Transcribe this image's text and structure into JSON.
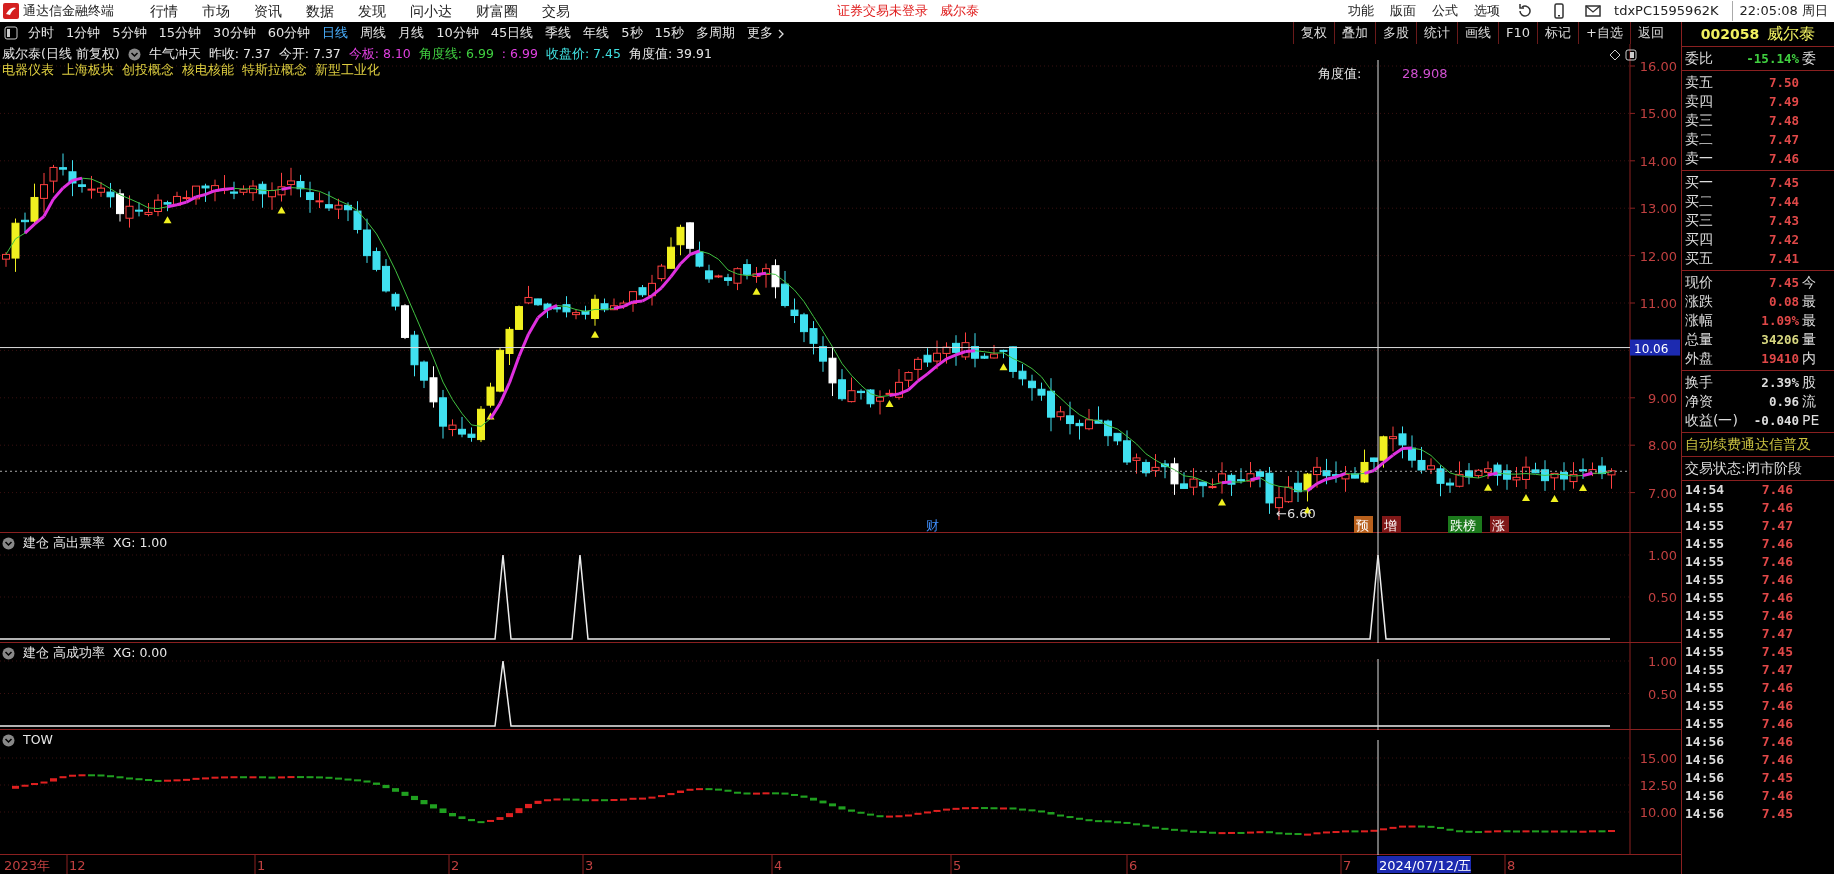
{
  "title_bar": {
    "app_title": "通达信金融终端",
    "menus": [
      "行情",
      "市场",
      "资讯",
      "数据",
      "发现",
      "问小达",
      "财富圈",
      "交易"
    ],
    "login_notice": "证券交易未登录",
    "stock_name": "威尔泰",
    "right_menus": [
      "功能",
      "版面",
      "公式",
      "选项"
    ],
    "terminal_id": "tdxPC1595962K",
    "clock": "22:05:08 周日"
  },
  "period_tabs": [
    {
      "label": "分时",
      "selected": false
    },
    {
      "label": "1分钟",
      "selected": false
    },
    {
      "label": "5分钟",
      "selected": false
    },
    {
      "label": "15分钟",
      "selected": false
    },
    {
      "label": "30分钟",
      "selected": false
    },
    {
      "label": "60分钟",
      "selected": false
    },
    {
      "label": "日线",
      "selected": true
    },
    {
      "label": "周线",
      "selected": false
    },
    {
      "label": "月线",
      "selected": false
    },
    {
      "label": "10分钟",
      "selected": false
    },
    {
      "label": "45日线",
      "selected": false
    },
    {
      "label": "季线",
      "selected": false
    },
    {
      "label": "年线",
      "selected": false
    },
    {
      "label": "5秒",
      "selected": false
    },
    {
      "label": "15秒",
      "selected": false
    },
    {
      "label": "多周期",
      "selected": false
    },
    {
      "label": "更多",
      "selected": false
    }
  ],
  "toolbar": [
    "复权",
    "叠加",
    "多股",
    "统计",
    "画线",
    "F10",
    "标记",
    "+自选",
    "返回"
  ],
  "main_chart": {
    "info": [
      {
        "text": "威尔泰(日线 前复权)",
        "color": "#e6e6e6"
      },
      {
        "text": "牛气冲天",
        "color": "#e6e6e6"
      },
      {
        "text": "昨收: 7.37",
        "color": "#e6e6e6"
      },
      {
        "text": "今开: 7.37",
        "color": "#e6e6e6"
      },
      {
        "text": "今板: 8.10",
        "color": "#e040e0"
      },
      {
        "text": "角度线: 6.99",
        "color": "#40d040"
      },
      {
        "text": ": 6.99",
        "color": "#e040e0"
      },
      {
        "text": "收盘价: 7.45",
        "color": "#40e0e0"
      },
      {
        "text": "角度值: 39.91",
        "color": "#e6e6e6"
      }
    ],
    "concepts": [
      "电器仪表",
      "上海板块",
      "创投概念",
      "核电核能",
      "特斯拉概念",
      "新型工业化"
    ],
    "angle_label": "角度值:",
    "angle_value": "28.908",
    "low_label": "←6.60",
    "cursor_price": "10.06",
    "price_axis": [
      "16.00",
      "15.00",
      "14.00",
      "13.00",
      "12.00",
      "11.00",
      "9.00",
      "8.00",
      "7.00"
    ],
    "events": [
      {
        "label": "财",
        "kind": "text",
        "color": "#4090ff"
      },
      {
        "label": "预",
        "kind": "tag",
        "color": "#b8601c"
      },
      {
        "label": "增",
        "kind": "tag",
        "color": "#801818"
      },
      {
        "label": "跌榜",
        "kind": "tag",
        "color": "#1c7a1c"
      },
      {
        "label": "涨",
        "kind": "tag",
        "color": "#801818"
      }
    ]
  },
  "indicators": [
    {
      "title": "建仓 高出票率",
      "reading": "XG: 1.00",
      "axis": [
        "1.00",
        "0.50"
      ]
    },
    {
      "title": "建仓 高成功率",
      "reading": "XG: 0.00",
      "axis": [
        "1.00",
        "0.50"
      ]
    }
  ],
  "tow": {
    "title": "TOW",
    "axis": [
      "15.00",
      "12.50",
      "10.00"
    ]
  },
  "date_axis": [
    {
      "label": "2023年",
      "selected": false
    },
    {
      "label": "12",
      "selected": false
    },
    {
      "label": "1",
      "selected": false
    },
    {
      "label": "2",
      "selected": false
    },
    {
      "label": "3",
      "selected": false
    },
    {
      "label": "4",
      "selected": false
    },
    {
      "label": "5",
      "selected": false
    },
    {
      "label": "6",
      "selected": false
    },
    {
      "label": "7",
      "selected": false
    },
    {
      "label": "2024/07/12/五",
      "selected": true
    },
    {
      "label": "8",
      "selected": false
    }
  ],
  "quote_panel": {
    "code": "002058",
    "name": "威尔泰",
    "ratio": {
      "label": "委比",
      "value": "-15.14%",
      "side": "委"
    },
    "asks": [
      {
        "label": "卖五",
        "price": "7.50"
      },
      {
        "label": "卖四",
        "price": "7.49"
      },
      {
        "label": "卖三",
        "price": "7.48"
      },
      {
        "label": "卖二",
        "price": "7.47"
      },
      {
        "label": "卖一",
        "price": "7.46"
      }
    ],
    "bids": [
      {
        "label": "买一",
        "price": "7.45"
      },
      {
        "label": "买二",
        "price": "7.44"
      },
      {
        "label": "买三",
        "price": "7.43"
      },
      {
        "label": "买四",
        "price": "7.42"
      },
      {
        "label": "买五",
        "price": "7.41"
      }
    ],
    "stats": [
      {
        "label": "现价",
        "value": "7.45",
        "side": "今",
        "color": "#e04848"
      },
      {
        "label": "涨跌",
        "value": "0.08",
        "side": "最",
        "color": "#e04848"
      },
      {
        "label": "涨幅",
        "value": "1.09%",
        "side": "最",
        "color": "#e04848"
      },
      {
        "label": "总量",
        "value": "34206",
        "side": "量",
        "color": "#d8d880"
      },
      {
        "label": "外盘",
        "value": "19410",
        "side": "内",
        "color": "#e04848"
      }
    ],
    "stats2": [
      {
        "label": "换手",
        "value": "2.39%",
        "side": "股"
      },
      {
        "label": "净资",
        "value": "0.96",
        "side": "流"
      },
      {
        "label": "收益(一)",
        "value": "-0.040",
        "side": "PE"
      }
    ],
    "notice": "自动续费通达信普及",
    "status": "交易状态:闭市阶段",
    "ticks": [
      {
        "time": "14:54",
        "price": "7.46"
      },
      {
        "time": "14:55",
        "price": "7.46"
      },
      {
        "time": "14:55",
        "price": "7.47"
      },
      {
        "time": "14:55",
        "price": "7.46"
      },
      {
        "time": "14:55",
        "price": "7.46"
      },
      {
        "time": "14:55",
        "price": "7.46"
      },
      {
        "time": "14:55",
        "price": "7.46"
      },
      {
        "time": "14:55",
        "price": "7.46"
      },
      {
        "time": "14:55",
        "price": "7.47"
      },
      {
        "time": "14:55",
        "price": "7.45"
      },
      {
        "time": "14:55",
        "price": "7.47"
      },
      {
        "time": "14:55",
        "price": "7.46"
      },
      {
        "time": "14:55",
        "price": "7.46"
      },
      {
        "time": "14:55",
        "price": "7.46"
      },
      {
        "time": "14:56",
        "price": "7.46"
      },
      {
        "time": "14:56",
        "price": "7.46"
      },
      {
        "time": "14:56",
        "price": "7.45"
      },
      {
        "time": "14:56",
        "price": "7.46"
      },
      {
        "time": "14:56",
        "price": "7.45"
      }
    ]
  }
}
